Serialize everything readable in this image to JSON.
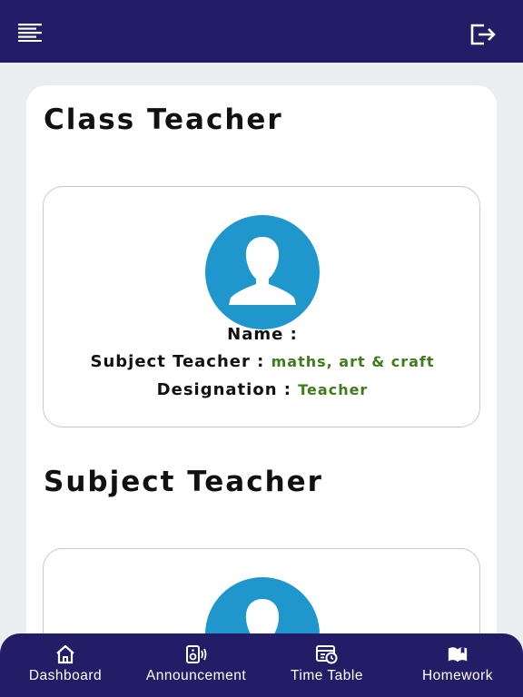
{
  "header": {
    "menu_icon": "menu-icon",
    "logout_icon": "logout-icon"
  },
  "sections": {
    "class_teacher_title": "Class Teacher",
    "subject_teacher_title": "Subject Teacher"
  },
  "class_teacher": {
    "avatar_icon": "user-avatar-icon",
    "name_label": "Name :",
    "name_value": "",
    "subject_label": "Subject Teacher :",
    "subject_value": "maths, art & craft",
    "designation_label": "Designation :",
    "designation_value": "Teacher"
  },
  "bottom_nav": {
    "items": [
      {
        "label": "Dashboard",
        "icon": "home-icon"
      },
      {
        "label": "Announcement",
        "icon": "speaker-icon"
      },
      {
        "label": "Time Table",
        "icon": "calendar-clock-icon"
      },
      {
        "label": "Homework",
        "icon": "book-icon"
      }
    ]
  },
  "colors": {
    "header_bg": "#231c66",
    "page_bg": "#ecedf1",
    "avatar_blue": "#1f97cc",
    "value_green": "#3f7a1b"
  }
}
